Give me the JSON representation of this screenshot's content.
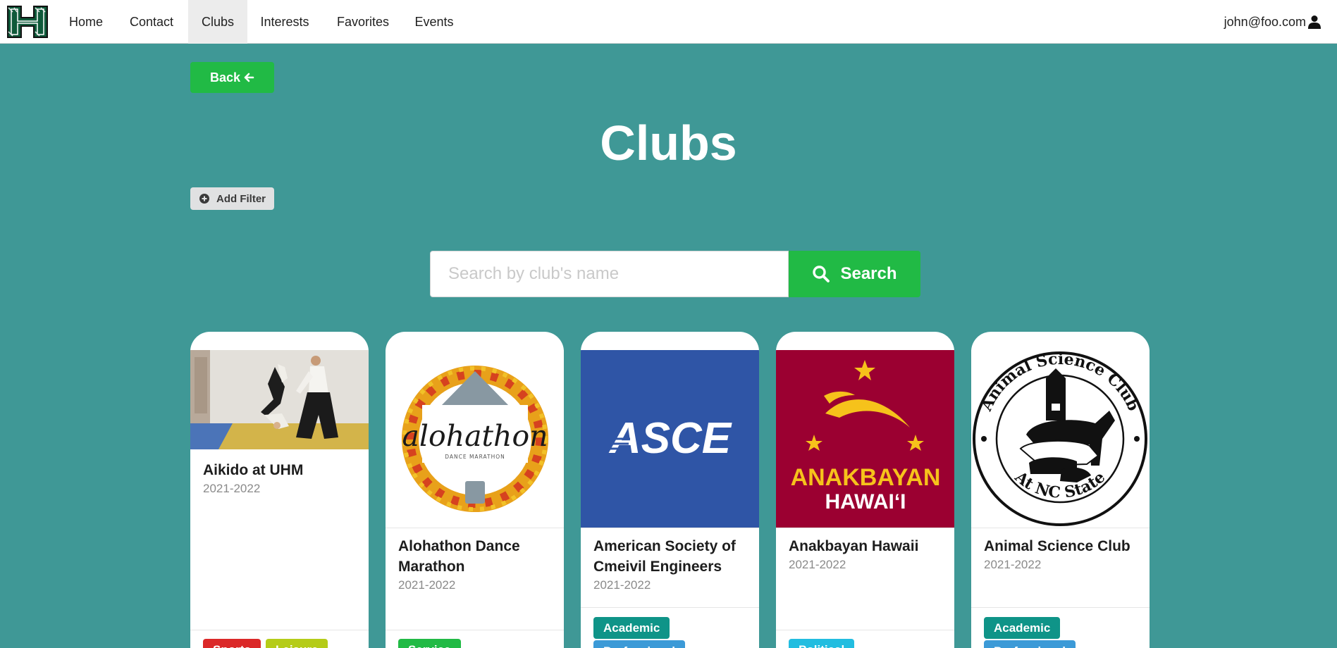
{
  "nav": {
    "logo_alt": "H",
    "items": [
      "Home",
      "Contact",
      "Clubs",
      "Interests",
      "Favorites",
      "Events"
    ],
    "active": "Clubs",
    "user_email": "john@foo.com",
    "user_icon": "user-icon"
  },
  "actions": {
    "back_label": "Back",
    "back_icon": "arrow-left-icon",
    "filter_label": "Add Filter",
    "filter_icon": "plus-circle-icon"
  },
  "page": {
    "title": "Clubs"
  },
  "search": {
    "placeholder": "Search by club's name",
    "value": "",
    "button_label": "Search",
    "button_icon": "search-icon"
  },
  "clubs": [
    {
      "name": "Aikido at UHM",
      "year": "2021-2022",
      "image": "aikido-photo",
      "tags": [
        {
          "label": "Sports",
          "color": "#db2828"
        },
        {
          "label": "Leisure",
          "color": "#b5cc18"
        }
      ]
    },
    {
      "name": "Alohathon Dance Marathon",
      "year": "2021-2022",
      "image": "alohathon-logo",
      "logo_text": "alohathon",
      "logo_subtext": "DANCE MARATHON",
      "tags": [
        {
          "label": "Service",
          "color": "#21ba45"
        }
      ]
    },
    {
      "name": "American Society of Cmeivil Engineers",
      "year": "2021-2022",
      "image": "asce-logo",
      "logo_text": "ASCE",
      "tags": [
        {
          "label": "Academic",
          "color": "#0f9488"
        },
        {
          "label": "Professional",
          "color": "#3c9ad7"
        }
      ]
    },
    {
      "name": "Anakbayan Hawaii",
      "year": "2021-2022",
      "image": "anakbayan-logo",
      "logo_text": "ANAKBAYAN",
      "logo_subtext": "HAWAIʻI",
      "tags": [
        {
          "label": "Political",
          "color": "#22bde0"
        }
      ]
    },
    {
      "name": "Animal Science Club",
      "year": "2021-2022",
      "image": "animal-science-logo",
      "logo_text": "Animal Science Club",
      "logo_subtext": "At NC State",
      "tags": [
        {
          "label": "Academic",
          "color": "#0f9488"
        },
        {
          "label": "Professional",
          "color": "#3c9ad7"
        }
      ]
    }
  ],
  "colors": {
    "background": "#3f9896",
    "primary_green": "#21ba45",
    "navbar": "#ffffff",
    "asce_blue": "#2f55a6",
    "anakbayan_red": "#9b0031",
    "anakbayan_gold": "#f6c21b"
  }
}
